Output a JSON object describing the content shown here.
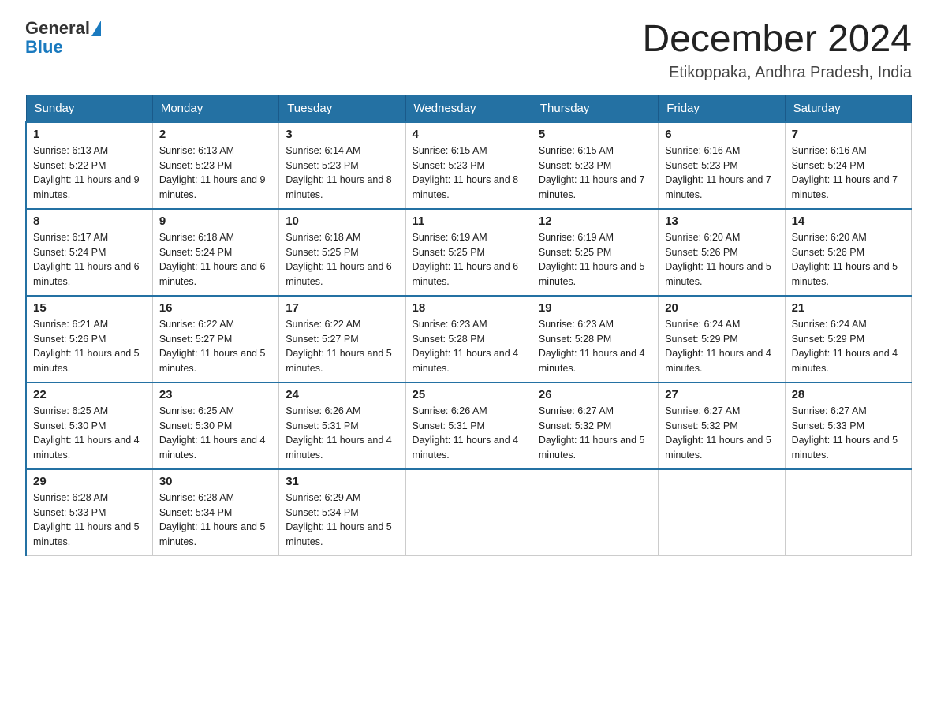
{
  "header": {
    "logo_general": "General",
    "logo_blue": "Blue",
    "month_title": "December 2024",
    "location": "Etikoppaka, Andhra Pradesh, India"
  },
  "days_of_week": [
    "Sunday",
    "Monday",
    "Tuesday",
    "Wednesday",
    "Thursday",
    "Friday",
    "Saturday"
  ],
  "weeks": [
    [
      {
        "day": "1",
        "sunrise": "6:13 AM",
        "sunset": "5:22 PM",
        "daylight": "11 hours and 9 minutes."
      },
      {
        "day": "2",
        "sunrise": "6:13 AM",
        "sunset": "5:23 PM",
        "daylight": "11 hours and 9 minutes."
      },
      {
        "day": "3",
        "sunrise": "6:14 AM",
        "sunset": "5:23 PM",
        "daylight": "11 hours and 8 minutes."
      },
      {
        "day": "4",
        "sunrise": "6:15 AM",
        "sunset": "5:23 PM",
        "daylight": "11 hours and 8 minutes."
      },
      {
        "day": "5",
        "sunrise": "6:15 AM",
        "sunset": "5:23 PM",
        "daylight": "11 hours and 7 minutes."
      },
      {
        "day": "6",
        "sunrise": "6:16 AM",
        "sunset": "5:23 PM",
        "daylight": "11 hours and 7 minutes."
      },
      {
        "day": "7",
        "sunrise": "6:16 AM",
        "sunset": "5:24 PM",
        "daylight": "11 hours and 7 minutes."
      }
    ],
    [
      {
        "day": "8",
        "sunrise": "6:17 AM",
        "sunset": "5:24 PM",
        "daylight": "11 hours and 6 minutes."
      },
      {
        "day": "9",
        "sunrise": "6:18 AM",
        "sunset": "5:24 PM",
        "daylight": "11 hours and 6 minutes."
      },
      {
        "day": "10",
        "sunrise": "6:18 AM",
        "sunset": "5:25 PM",
        "daylight": "11 hours and 6 minutes."
      },
      {
        "day": "11",
        "sunrise": "6:19 AM",
        "sunset": "5:25 PM",
        "daylight": "11 hours and 6 minutes."
      },
      {
        "day": "12",
        "sunrise": "6:19 AM",
        "sunset": "5:25 PM",
        "daylight": "11 hours and 5 minutes."
      },
      {
        "day": "13",
        "sunrise": "6:20 AM",
        "sunset": "5:26 PM",
        "daylight": "11 hours and 5 minutes."
      },
      {
        "day": "14",
        "sunrise": "6:20 AM",
        "sunset": "5:26 PM",
        "daylight": "11 hours and 5 minutes."
      }
    ],
    [
      {
        "day": "15",
        "sunrise": "6:21 AM",
        "sunset": "5:26 PM",
        "daylight": "11 hours and 5 minutes."
      },
      {
        "day": "16",
        "sunrise": "6:22 AM",
        "sunset": "5:27 PM",
        "daylight": "11 hours and 5 minutes."
      },
      {
        "day": "17",
        "sunrise": "6:22 AM",
        "sunset": "5:27 PM",
        "daylight": "11 hours and 5 minutes."
      },
      {
        "day": "18",
        "sunrise": "6:23 AM",
        "sunset": "5:28 PM",
        "daylight": "11 hours and 4 minutes."
      },
      {
        "day": "19",
        "sunrise": "6:23 AM",
        "sunset": "5:28 PM",
        "daylight": "11 hours and 4 minutes."
      },
      {
        "day": "20",
        "sunrise": "6:24 AM",
        "sunset": "5:29 PM",
        "daylight": "11 hours and 4 minutes."
      },
      {
        "day": "21",
        "sunrise": "6:24 AM",
        "sunset": "5:29 PM",
        "daylight": "11 hours and 4 minutes."
      }
    ],
    [
      {
        "day": "22",
        "sunrise": "6:25 AM",
        "sunset": "5:30 PM",
        "daylight": "11 hours and 4 minutes."
      },
      {
        "day": "23",
        "sunrise": "6:25 AM",
        "sunset": "5:30 PM",
        "daylight": "11 hours and 4 minutes."
      },
      {
        "day": "24",
        "sunrise": "6:26 AM",
        "sunset": "5:31 PM",
        "daylight": "11 hours and 4 minutes."
      },
      {
        "day": "25",
        "sunrise": "6:26 AM",
        "sunset": "5:31 PM",
        "daylight": "11 hours and 4 minutes."
      },
      {
        "day": "26",
        "sunrise": "6:27 AM",
        "sunset": "5:32 PM",
        "daylight": "11 hours and 5 minutes."
      },
      {
        "day": "27",
        "sunrise": "6:27 AM",
        "sunset": "5:32 PM",
        "daylight": "11 hours and 5 minutes."
      },
      {
        "day": "28",
        "sunrise": "6:27 AM",
        "sunset": "5:33 PM",
        "daylight": "11 hours and 5 minutes."
      }
    ],
    [
      {
        "day": "29",
        "sunrise": "6:28 AM",
        "sunset": "5:33 PM",
        "daylight": "11 hours and 5 minutes."
      },
      {
        "day": "30",
        "sunrise": "6:28 AM",
        "sunset": "5:34 PM",
        "daylight": "11 hours and 5 minutes."
      },
      {
        "day": "31",
        "sunrise": "6:29 AM",
        "sunset": "5:34 PM",
        "daylight": "11 hours and 5 minutes."
      },
      null,
      null,
      null,
      null
    ]
  ]
}
